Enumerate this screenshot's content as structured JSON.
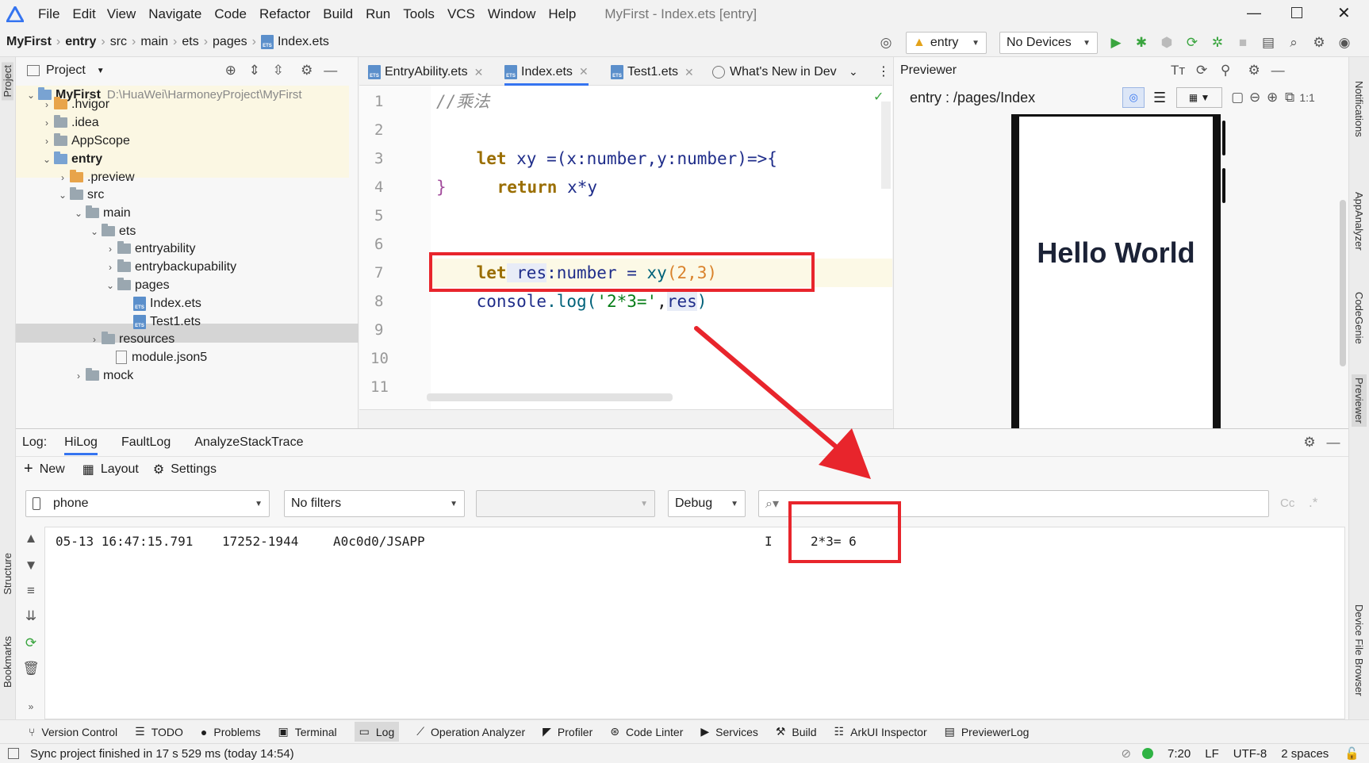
{
  "menu": {
    "items": [
      "File",
      "Edit",
      "View",
      "Navigate",
      "Code",
      "Refactor",
      "Build",
      "Run",
      "Tools",
      "VCS",
      "Window",
      "Help"
    ],
    "window_title": "MyFirst - Index.ets [entry]"
  },
  "breadcrumb": [
    "MyFirst",
    "entry",
    "src",
    "main",
    "ets",
    "pages",
    "Index.ets"
  ],
  "toolbar": {
    "run_config": "entry",
    "device": "No Devices"
  },
  "project_panel": {
    "title": "Project",
    "tree": [
      {
        "label": "MyFirst",
        "path": "D:\\HuaWei\\HarmoneyProject\\MyFirst"
      },
      {
        "label": ".hvigor"
      },
      {
        "label": ".idea"
      },
      {
        "label": "AppScope"
      },
      {
        "label": "entry"
      },
      {
        "label": ".preview"
      },
      {
        "label": "src"
      },
      {
        "label": "main"
      },
      {
        "label": "ets"
      },
      {
        "label": "entryability"
      },
      {
        "label": "entrybackupability"
      },
      {
        "label": "pages"
      },
      {
        "label": "Index.ets"
      },
      {
        "label": "Test1.ets"
      },
      {
        "label": "resources"
      },
      {
        "label": "module.json5"
      },
      {
        "label": "mock"
      }
    ]
  },
  "editor": {
    "tabs": [
      "EntryAbility.ets",
      "Index.ets",
      "Test1.ets",
      "What's New in Dev"
    ],
    "line_numbers": [
      "1",
      "2",
      "3",
      "4",
      "5",
      "6",
      "7",
      "8",
      "9",
      "10",
      "11"
    ],
    "lines": {
      "l1_comment": "//乘法",
      "l2_let": "let",
      "l2_rest": " xy =(x:number,y:number)=>{",
      "l3_return": "return",
      "l3_rest": " x*y",
      "l4": "}",
      "l6_let": "let",
      "l6_var": " res",
      "l6_rest": ":number = ",
      "l6_fn": "xy",
      "l6_args": "(2,3)",
      "l7_console": "console",
      "l7_log": ".log(",
      "l7_str": "'2*3='",
      "l7_comma": ",",
      "l7_res": "res",
      "l7_close": ")"
    }
  },
  "previewer": {
    "title": "Previewer",
    "route": "entry : /pages/Index",
    "content": "Hello World"
  },
  "log_panel": {
    "label": "Log:",
    "tabs": [
      "HiLog",
      "FaultLog",
      "AnalyzeStackTrace"
    ],
    "actions": [
      "New",
      "Layout",
      "Settings"
    ],
    "device": "phone",
    "filter": "No filters",
    "process": "",
    "level": "Debug",
    "search_placeholder": "",
    "entry": {
      "time": "05-13 16:47:15.791",
      "pid": "17252-1944",
      "tag": "A0c0d0/JSAPP",
      "level": "I",
      "message": "2*3= 6"
    }
  },
  "bottom_toolbar": [
    "Version Control",
    "TODO",
    "Problems",
    "Terminal",
    "Log",
    "Operation Analyzer",
    "Profiler",
    "Code Linter",
    "Services",
    "Build",
    "ArkUI Inspector",
    "PreviewerLog"
  ],
  "status_bar": {
    "message": "Sync project finished in 17 s 529 ms (today 14:54)",
    "position": "7:20",
    "line_sep": "LF",
    "encoding": "UTF-8",
    "indent": "2 spaces"
  },
  "side_tools": {
    "left": [
      "Project",
      "Structure",
      "Bookmarks"
    ],
    "right": [
      "Notifications",
      "AppAnalyzer",
      "CodeGenie",
      "Previewer",
      "Device File Browser"
    ]
  },
  "colors": {
    "highlight_box": "#e8252c",
    "arrow": "#e8252c",
    "accent": "#3574f0"
  }
}
